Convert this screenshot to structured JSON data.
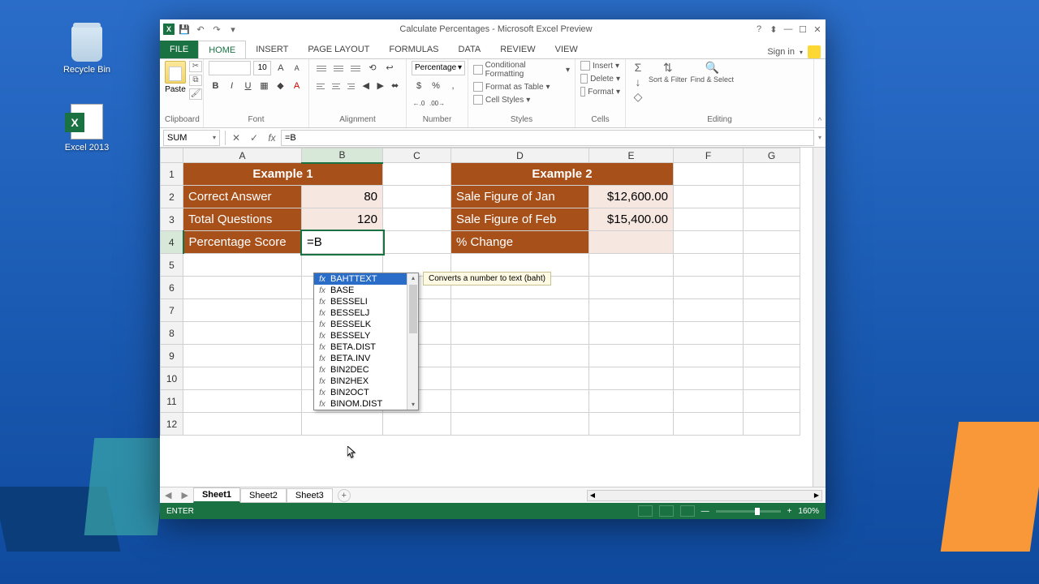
{
  "desktop": {
    "recycle": "Recycle Bin",
    "excel": "Excel 2013"
  },
  "title": "Calculate Percentages - Microsoft Excel Preview",
  "qat": {
    "save": "💾",
    "undo": "↶",
    "redo": "↷"
  },
  "winbtns": {
    "help": "?",
    "ribmin": "⬍",
    "min": "—",
    "max": "☐",
    "close": "✕"
  },
  "tabs": {
    "file": "FILE",
    "home": "HOME",
    "insert": "INSERT",
    "pagelayout": "PAGE LAYOUT",
    "formulas": "FORMULAS",
    "data": "DATA",
    "review": "REVIEW",
    "view": "VIEW"
  },
  "signin": "Sign in",
  "ribbon": {
    "clipboard": {
      "paste": "Paste",
      "label": "Clipboard"
    },
    "font": {
      "size": "10",
      "b": "B",
      "i": "I",
      "u": "U",
      "label": "Font"
    },
    "alignment": {
      "label": "Alignment"
    },
    "number": {
      "format": "Percentage",
      "label": "Number",
      "sym1": "$",
      "sym2": "%",
      "sym3": ",",
      "dec1": "←.0",
      "dec2": ".00→"
    },
    "styles": {
      "cond": "Conditional Formatting",
      "table": "Format as Table",
      "cell": "Cell Styles",
      "label": "Styles"
    },
    "cells": {
      "ins": "Insert",
      "del": "Delete",
      "fmt": "Format",
      "label": "Cells"
    },
    "editing": {
      "sum": "Σ",
      "sort": "Sort & Filter",
      "find": "Find & Select",
      "label": "Editing"
    }
  },
  "formula": {
    "name": "SUM",
    "cancel": "✕",
    "enter": "✓",
    "fx": "fx",
    "value": "=B"
  },
  "columns": [
    "A",
    "B",
    "C",
    "D",
    "E",
    "F",
    "G"
  ],
  "rows": [
    "1",
    "2",
    "3",
    "4",
    "5",
    "6",
    "7",
    "8",
    "9",
    "10",
    "11",
    "12"
  ],
  "cells": {
    "ex1_title": "Example 1",
    "ex2_title": "Example 2",
    "a2": "Correct Answer",
    "b2": "80",
    "a3": "Total Questions",
    "b3": "120",
    "a4": "Percentage Score",
    "b4": "=B",
    "d2": "Sale Figure of Jan",
    "e2": "$12,600.00",
    "d3": "Sale Figure of Feb",
    "e3": "$15,400.00",
    "d4": "% Change"
  },
  "autocomplete": {
    "tooltip": "Converts a number to text (baht)",
    "items": [
      "BAHTTEXT",
      "BASE",
      "BESSELI",
      "BESSELJ",
      "BESSELK",
      "BESSELY",
      "BETA.DIST",
      "BETA.INV",
      "BIN2DEC",
      "BIN2HEX",
      "BIN2OCT",
      "BINOM.DIST"
    ]
  },
  "sheets": {
    "s1": "Sheet1",
    "s2": "Sheet2",
    "s3": "Sheet3",
    "add": "+"
  },
  "status": {
    "mode": "ENTER",
    "zoom": "160%"
  }
}
